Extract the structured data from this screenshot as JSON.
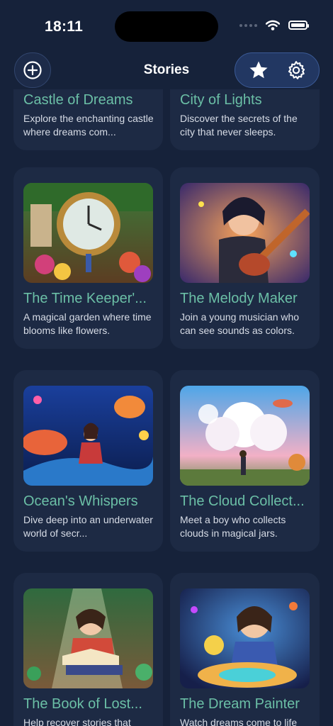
{
  "status_bar": {
    "time": "18:11"
  },
  "nav": {
    "title": "Stories"
  },
  "stories": [
    {
      "title": "Castle of Dreams",
      "description": "Explore the enchanting castle where dreams com..."
    },
    {
      "title": "City of Lights",
      "description": "Discover the secrets of the city that never sleeps."
    },
    {
      "title": "The Time Keeper'...",
      "description": "A magical garden where time blooms like flowers."
    },
    {
      "title": "The Melody Maker",
      "description": "Join a young musician who can see sounds as colors."
    },
    {
      "title": "Ocean's Whispers",
      "description": "Dive deep into an underwater world of secr..."
    },
    {
      "title": "The Cloud Collect...",
      "description": "Meet a boy who collects clouds in magical jars."
    },
    {
      "title": "The Book of Lost...",
      "description": "Help recover stories that"
    },
    {
      "title": "The Dream Painter",
      "description": "Watch dreams come to life"
    }
  ]
}
